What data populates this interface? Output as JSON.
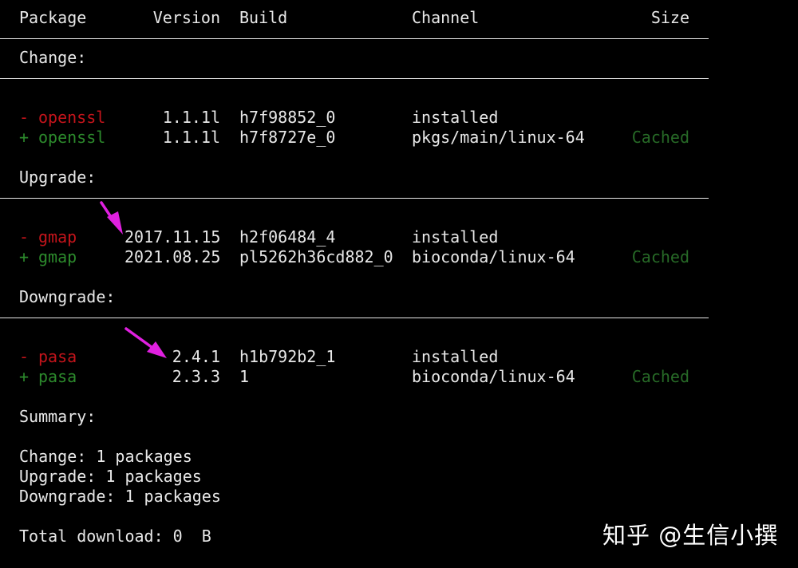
{
  "header": {
    "package": "Package",
    "version": "Version",
    "build": "Build",
    "channel": "Channel",
    "size": "Size"
  },
  "sections": {
    "change": {
      "title": "Change:",
      "rows": [
        {
          "sign": "-",
          "name": "openssl",
          "version": "1.1.1l",
          "build": "h7f98852_0",
          "channel": "installed",
          "size": ""
        },
        {
          "sign": "+",
          "name": "openssl",
          "version": "1.1.1l",
          "build": "h7f8727e_0",
          "channel": "pkgs/main/linux-64",
          "size": "Cached"
        }
      ]
    },
    "upgrade": {
      "title": "Upgrade:",
      "rows": [
        {
          "sign": "-",
          "name": "gmap",
          "version": "2017.11.15",
          "build": "h2f06484_4",
          "channel": "installed",
          "size": ""
        },
        {
          "sign": "+",
          "name": "gmap",
          "version": "2021.08.25",
          "build": "pl5262h36cd882_0",
          "channel": "bioconda/linux-64",
          "size": "Cached"
        }
      ]
    },
    "downgrade": {
      "title": "Downgrade:",
      "rows": [
        {
          "sign": "-",
          "name": "pasa",
          "version": "2.4.1",
          "build": "h1b792b2_1",
          "channel": "installed",
          "size": ""
        },
        {
          "sign": "+",
          "name": "pasa",
          "version": "2.3.3",
          "build": "1",
          "channel": "bioconda/linux-64",
          "size": "Cached"
        }
      ]
    }
  },
  "summary": {
    "title": "Summary:",
    "change": "Change: 1 packages",
    "upgrade": "Upgrade: 1 packages",
    "downgrade": "Downgrade: 1 packages",
    "total": "Total download: 0  B"
  },
  "watermark": "知乎 @生信小撰",
  "colors": {
    "background": "#000000",
    "text": "#e8e8e8",
    "removed": "#c4141b",
    "added": "#2c8a2c",
    "cached": "#276a27",
    "arrow": "#e020e0"
  }
}
